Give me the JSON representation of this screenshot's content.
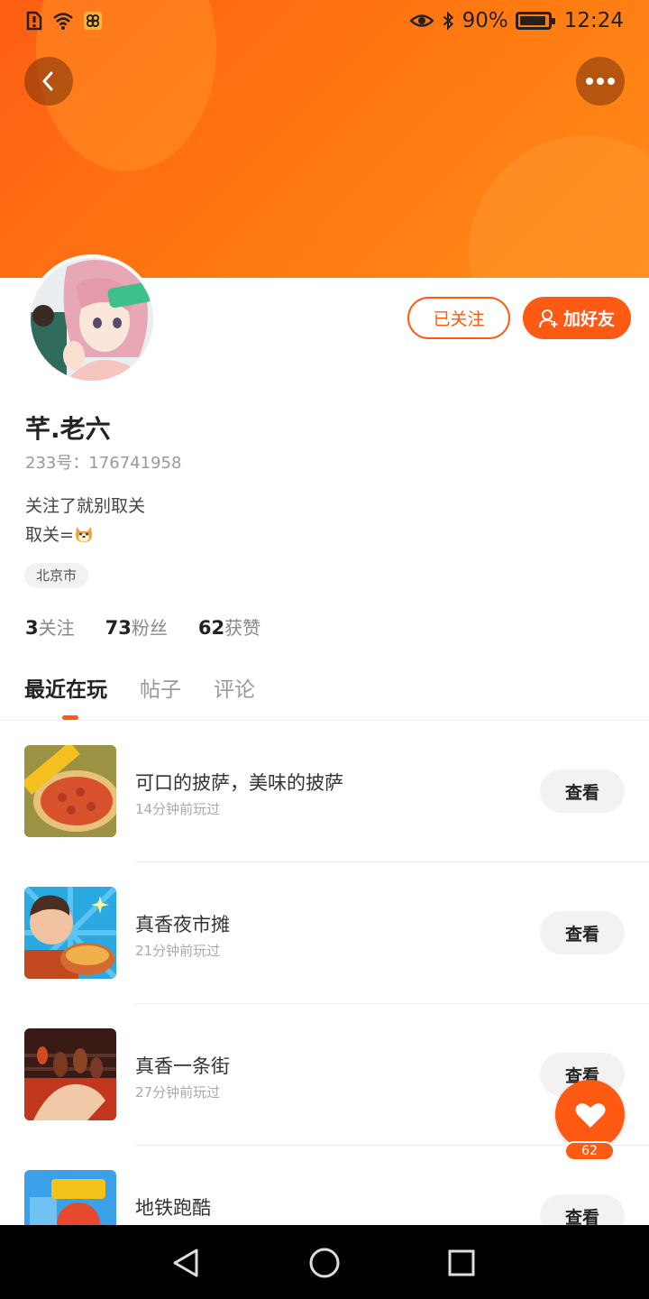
{
  "status_bar": {
    "battery": "90%",
    "time": "12:24",
    "icons": [
      "alert-icon",
      "wifi-icon",
      "app-notification-icon",
      "eye-icon",
      "bluetooth-icon",
      "battery-icon"
    ]
  },
  "header": {
    "back_icon": "chevron-left-icon",
    "more_icon": "more-dots-icon"
  },
  "profile": {
    "followed_label": "已关注",
    "add_friend_label": "加好友",
    "username": "芊.老六",
    "uid": "233号：176741958",
    "bio_line1": "关注了就别取关",
    "bio_line2": "取关=",
    "location": "北京市"
  },
  "stats": [
    {
      "value": "3",
      "label": "关注"
    },
    {
      "value": "73",
      "label": "粉丝"
    },
    {
      "value": "62",
      "label": "获赞"
    }
  ],
  "tabs": [
    {
      "label": "最近在玩",
      "active": true
    },
    {
      "label": "帖子",
      "active": false
    },
    {
      "label": "评论",
      "active": false
    }
  ],
  "games": [
    {
      "name": "可口的披萨，美味的披萨",
      "time": "14分钟前玩过",
      "button": "查看"
    },
    {
      "name": "真香夜市摊",
      "time": "21分钟前玩过",
      "button": "查看"
    },
    {
      "name": "真香一条街",
      "time": "27分钟前玩过",
      "button": "查看"
    },
    {
      "name": "地铁跑酷",
      "time": "",
      "button": "查看"
    }
  ],
  "like_fab": {
    "count": "62"
  },
  "colors": {
    "accent": "#ff5a14",
    "banner": "#ff7a12"
  }
}
